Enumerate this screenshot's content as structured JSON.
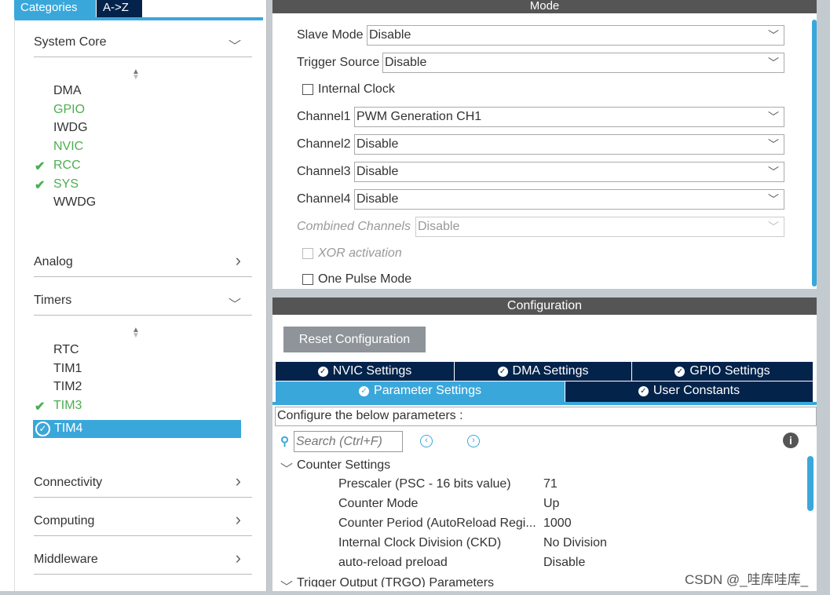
{
  "left": {
    "tabs": [
      "Categories",
      "A->Z"
    ],
    "categories": [
      {
        "label": "System Core",
        "chevron": "chevron-down-icon"
      },
      {
        "label": "Analog",
        "chevron": "chevron-right-icon"
      },
      {
        "label": "Timers",
        "chevron": "chevron-down-icon"
      },
      {
        "label": "Connectivity",
        "chevron": "chevron-right-icon"
      },
      {
        "label": "Computing",
        "chevron": "chevron-right-icon"
      },
      {
        "label": "Middleware",
        "chevron": "chevron-right-icon"
      }
    ],
    "system_core_items": [
      {
        "label": "DMA",
        "state": "normal"
      },
      {
        "label": "GPIO",
        "state": "green"
      },
      {
        "label": "IWDG",
        "state": "normal"
      },
      {
        "label": "NVIC",
        "state": "green"
      },
      {
        "label": "RCC",
        "state": "checked"
      },
      {
        "label": "SYS",
        "state": "checked"
      },
      {
        "label": "WWDG",
        "state": "normal"
      }
    ],
    "timer_items": [
      {
        "label": "RTC",
        "state": "normal"
      },
      {
        "label": "TIM1",
        "state": "normal"
      },
      {
        "label": "TIM2",
        "state": "normal"
      },
      {
        "label": "TIM3",
        "state": "checked"
      },
      {
        "label": "TIM4",
        "state": "selected"
      }
    ]
  },
  "mode": {
    "title": "Mode",
    "slave_mode": {
      "label": "Slave Mode",
      "value": "Disable"
    },
    "trigger_source": {
      "label": "Trigger Source",
      "value": "Disable"
    },
    "internal_clock": "Internal Clock",
    "channels": [
      {
        "label": "Channel1",
        "value": "PWM Generation CH1"
      },
      {
        "label": "Channel2",
        "value": "Disable"
      },
      {
        "label": "Channel3",
        "value": "Disable"
      },
      {
        "label": "Channel4",
        "value": "Disable"
      }
    ],
    "combined": {
      "label": "Combined Channels",
      "value": "Disable"
    },
    "xor": "XOR activation",
    "one_pulse": "One Pulse Mode"
  },
  "config": {
    "title": "Configuration",
    "reset": "Reset Configuration",
    "tabs_row1": [
      "NVIC Settings",
      "DMA Settings",
      "GPIO Settings"
    ],
    "tabs_row2": [
      "Parameter Settings",
      "User Constants"
    ],
    "configure_text": "Configure the below parameters :",
    "search_placeholder": "Search (Ctrl+F)",
    "group": "Counter Settings",
    "params": [
      {
        "name": "Prescaler (PSC - 16 bits value)",
        "value": "71"
      },
      {
        "name": "Counter Mode",
        "value": "Up"
      },
      {
        "name": "Counter Period (AutoReload Regi...",
        "value": "1000"
      },
      {
        "name": "Internal Clock Division (CKD)",
        "value": "No Division"
      },
      {
        "name": "auto-reload preload",
        "value": "Disable"
      }
    ],
    "next_group": "Trigger Output (TRGO) Parameters"
  },
  "watermark": "CSDN @_哇库哇库_",
  "colors": {
    "accent": "#3aa7db",
    "navy": "#03234b",
    "green": "#4caf50"
  }
}
